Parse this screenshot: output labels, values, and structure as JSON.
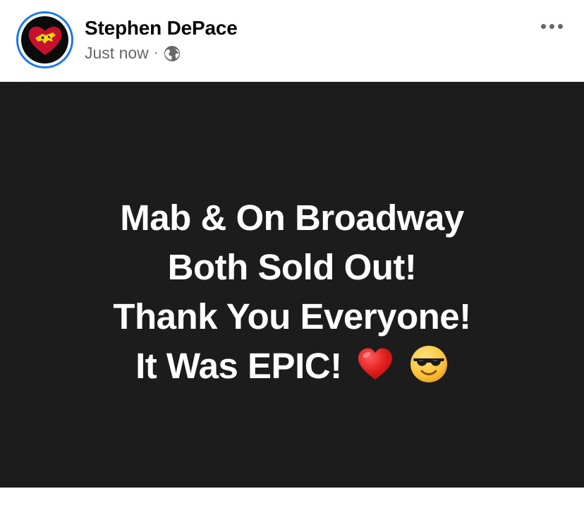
{
  "post": {
    "author": "Stephen DePace",
    "timestamp": "Just now",
    "separator": "·",
    "audience_icon": "globe-icon",
    "more_icon": "more-options-icon",
    "avatar_icon": "heart-logo-icon"
  },
  "status": {
    "lines": [
      "Mab & On Broadway",
      "Both Sold Out!",
      "Thank You Everyone!",
      "It Was EPIC!"
    ],
    "emojis": [
      "red-heart-emoji",
      "smiling-face-with-sunglasses-emoji"
    ]
  },
  "colors": {
    "status_background": "#1c1c1d",
    "status_text": "#ffffff",
    "author_text": "#050505",
    "meta_text": "#65676b",
    "avatar_ring": "#1877f2",
    "heart_red": "#c8102e",
    "logo_yellow": "#f5d90a"
  }
}
